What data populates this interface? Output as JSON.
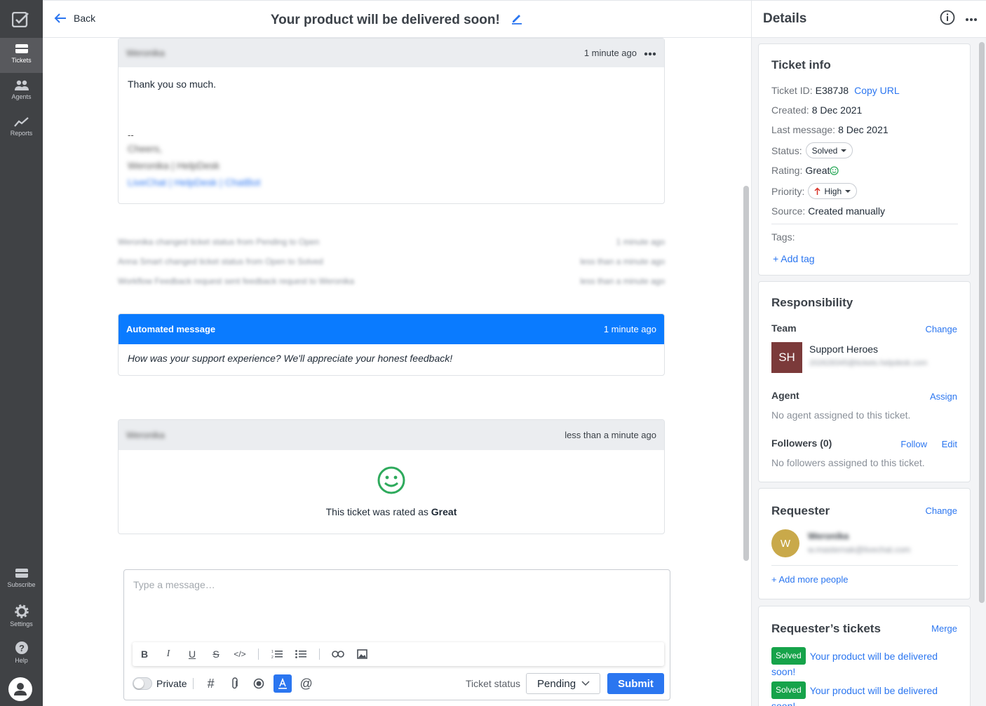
{
  "nav": {
    "items": [
      {
        "label": "Tickets",
        "icon": "tickets-icon"
      },
      {
        "label": "Agents",
        "icon": "agents-icon"
      },
      {
        "label": "Reports",
        "icon": "reports-icon"
      }
    ],
    "bottom": [
      {
        "label": "Subscribe",
        "icon": "subscribe-icon"
      },
      {
        "label": "Settings",
        "icon": "settings-icon"
      },
      {
        "label": "Help",
        "icon": "help-icon"
      }
    ]
  },
  "header": {
    "back_label": "Back",
    "title": "Your product will be delivered soon!"
  },
  "messages": {
    "first": {
      "author": "Weronika",
      "time": "1 minute ago",
      "body": "Thank you so much.",
      "sig_dash": "--",
      "sig_1": "Cheers,",
      "sig_2": "Weronika | HelpDesk",
      "sig_3": "LiveChat | HelpDesk | ChatBot"
    },
    "events": [
      {
        "text": "Weronika changed ticket status from Pending to Open",
        "time": "1 minute ago"
      },
      {
        "text": "Anna Smart changed ticket status from Open to Solved",
        "time": "less than a minute ago"
      },
      {
        "text": "Workflow Feedback request sent feedback request to Weronika",
        "time": "less than a minute ago"
      }
    ],
    "automated": {
      "label": "Automated message",
      "time": "1 minute ago",
      "body": "How was your support experience? We'll appreciate your honest feedback!"
    },
    "rating": {
      "author": "Weronika",
      "time": "less than a minute ago",
      "text": "This ticket was rated as",
      "value": "Great"
    }
  },
  "composer": {
    "placeholder": "Type a message…",
    "private_label": "Private",
    "status_label": "Ticket status",
    "status_value": "Pending",
    "submit_label": "Submit"
  },
  "details": {
    "title": "Details",
    "ticket_info": {
      "title": "Ticket info",
      "id_label": "Ticket ID:",
      "id_value": "E387J8",
      "copy_url": "Copy URL",
      "created_label": "Created:",
      "created_value": "8 Dec 2021",
      "last_label": "Last message:",
      "last_value": "8 Dec 2021",
      "status_label": "Status:",
      "status_value": "Solved",
      "rating_label": "Rating:",
      "rating_value": "Great",
      "priority_label": "Priority:",
      "priority_value": "High",
      "source_label": "Source:",
      "source_value": "Created manually",
      "tags_label": "Tags:",
      "add_tag": "+ Add tag"
    },
    "responsibility": {
      "title": "Responsibility",
      "team_label": "Team",
      "team_change": "Change",
      "team_initials": "SH",
      "team_name": "Support Heroes",
      "team_email": "202628345@tickets.helpdesk.com",
      "agent_label": "Agent",
      "agent_assign": "Assign",
      "agent_empty": "No agent assigned to this ticket.",
      "followers_label": "Followers (0)",
      "follow": "Follow",
      "edit": "Edit",
      "followers_empty": "No followers assigned to this ticket."
    },
    "requester": {
      "title": "Requester",
      "change": "Change",
      "initial": "W",
      "name": "Weronika",
      "email": "w.masternak@livechat.com",
      "add_more": "+ Add more people"
    },
    "requester_tickets": {
      "title": "Requester’s tickets",
      "merge": "Merge",
      "items": [
        {
          "badge": "Solved",
          "title": "Your product will be delivered soon!"
        },
        {
          "badge": "Solved",
          "title": "Your product will be delivered soon!"
        }
      ]
    }
  },
  "colors": {
    "nav_bg": "#404245",
    "accent": "#2b76f0",
    "automated_header": "#0a7bff",
    "success": "#16a34a"
  }
}
